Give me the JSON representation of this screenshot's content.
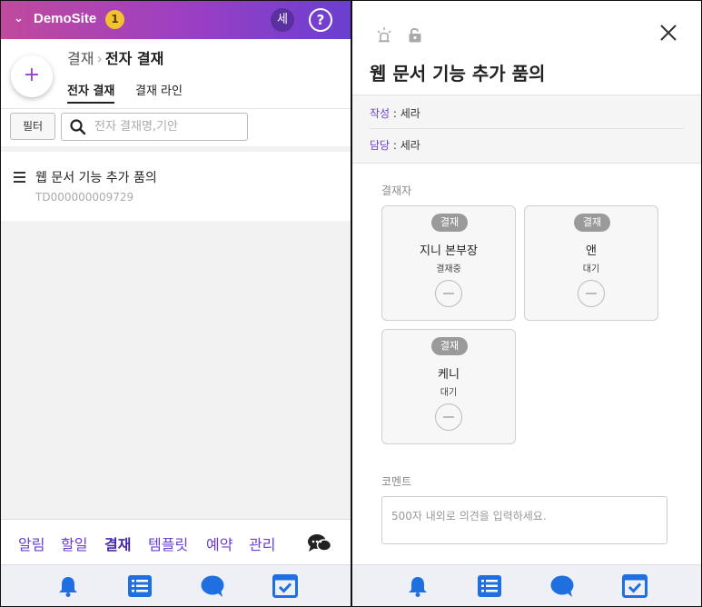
{
  "topbar": {
    "site_name": "DemoSite",
    "badge_count": "1",
    "avatar": "세",
    "help": "?"
  },
  "header": {
    "add": "+",
    "breadcrumb_parent": "결재",
    "breadcrumb_sep": "›",
    "breadcrumb_current": "전자 결재",
    "tabs": [
      {
        "label": "전자 결재"
      },
      {
        "label": "결재 라인"
      }
    ]
  },
  "filter": {
    "button": "필터",
    "search_placeholder": "전자 결재명,기안"
  },
  "list": [
    {
      "title": "웹 문서 기능 추가 품의",
      "code": "TD000000009729"
    }
  ],
  "bottom_tabs": [
    {
      "label": "알림"
    },
    {
      "label": "할일"
    },
    {
      "label": "결재"
    },
    {
      "label": "템플릿"
    },
    {
      "label": "예약"
    },
    {
      "label": "관리"
    }
  ],
  "detail": {
    "title": "웹 문서 기능 추가 품의",
    "author_key": "작성",
    "author_value": " : 세라",
    "owner_key": "담당",
    "owner_value": " : 세라",
    "approvers_label": "결재자",
    "approvers": [
      {
        "pill": "결재",
        "name": "지니 본부장",
        "status": "결재중"
      },
      {
        "pill": "결재",
        "name": "앤",
        "status": "대기"
      },
      {
        "pill": "결재",
        "name": "케니",
        "status": "대기"
      }
    ],
    "comment_label": "코멘트",
    "comment_placeholder": "500자 내외로 의견을 입력하세요."
  },
  "colors": {
    "accent": "#6a3fd0",
    "dock_icon": "#1e6fe0"
  },
  "icons": [
    "chevron-down-icon",
    "help-icon",
    "plus-icon",
    "search-icon",
    "menu-icon",
    "chat-bubbles-icon",
    "bell-icon",
    "list-icon",
    "chat-icon",
    "check-icon",
    "siren-icon",
    "unlock-icon",
    "close-icon",
    "minus-circle-icon"
  ]
}
